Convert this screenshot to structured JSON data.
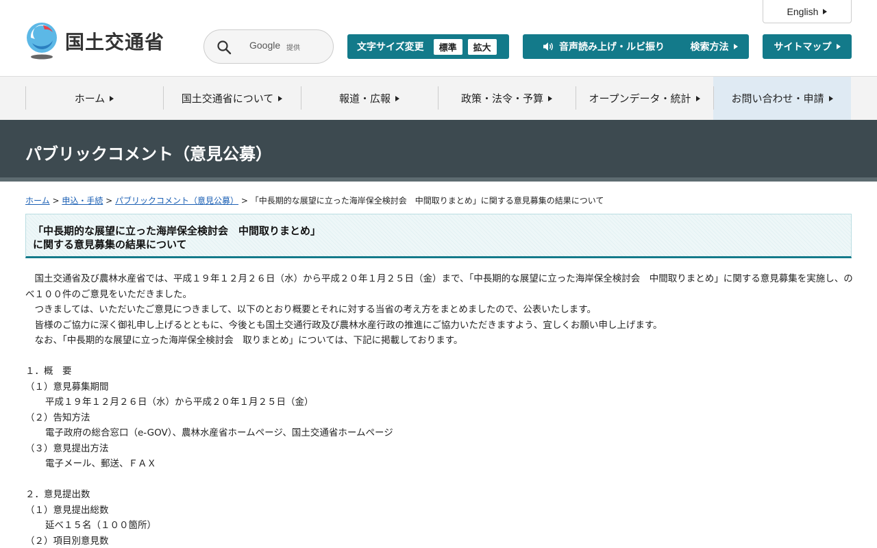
{
  "header": {
    "site_name": "国土交通省",
    "search": {
      "google_label": "Google",
      "provided_label": "提供"
    },
    "english_label": "English",
    "fontsize": {
      "label": "文字サイズ変更",
      "standard": "標準",
      "large": "拡大"
    },
    "voice_label": "音声読み上げ・ルビ振り",
    "howto_label": "検索方法",
    "sitemap_label": "サイトマップ"
  },
  "gnav": {
    "items": [
      {
        "label": "ホーム"
      },
      {
        "label": "国土交通省について"
      },
      {
        "label": "報道・広報"
      },
      {
        "label": "政策・法令・予算"
      },
      {
        "label": "オープンデータ・統計"
      },
      {
        "label": "お問い合わせ・申請"
      }
    ]
  },
  "page": {
    "section_title": "パブリックコメント（意見公募）",
    "breadcrumb": {
      "home": "ホーム",
      "apply": "申込・手続",
      "pubcom": "パブリックコメント（意見公募）",
      "current": "「中長期的な展望に立った海岸保全検討会　中間取りまとめ」に関する意見募集の結果について",
      "sep": " > "
    },
    "heading_line1": "「中長期的な展望に立った海岸保全検討会　中間取りまとめ」",
    "heading_line2": "に関する意見募集の結果について"
  },
  "content": {
    "para1": "　国土交通省及び農林水産省では、平成１９年１２月２６日（水）から平成２０年１月２５日（金）まで、「中長期的な展望に立った海岸保全検討会　中間取りまとめ」に関する意見募集を実施し、のべ１００件のご意見をいただきました。",
    "para2": "　つきましては、いただいたご意見につきまして、以下のとおり概要とそれに対する当省の考え方をまとめましたので、公表いたします。",
    "para3": "　皆様のご協力に深く御礼申し上げるとともに、今後とも国土交通行政及び農林水産行政の推進にご協力いただきますよう、宜しくお願い申し上げます。",
    "para4": "　なお、「中長期的な展望に立った海岸保全検討会　取りまとめ」については、下記に掲載しております。",
    "s1_title": "１．概　要",
    "s1_1": "（１）意見募集期間",
    "s1_1v": "平成１９年１２月２６日（水）から平成２０年１月２５日（金）",
    "s1_2": "（２）告知方法",
    "s1_2v": "電子政府の総合窓口（e-GOV）、農林水産省ホームページ、国土交通省ホームページ",
    "s1_3": "（３）意見提出方法",
    "s1_3v": "電子メール、郵送、ＦＡＸ",
    "s2_title": "２．意見提出数",
    "s2_1": "（１）意見提出総数",
    "s2_1v": "延べ１５名（１００箇所）",
    "s2_2": "（２）項目別意見数"
  },
  "colors": {
    "accent": "#137a8a",
    "title_band": "#3d4a50",
    "link": "#1a5fb4"
  }
}
